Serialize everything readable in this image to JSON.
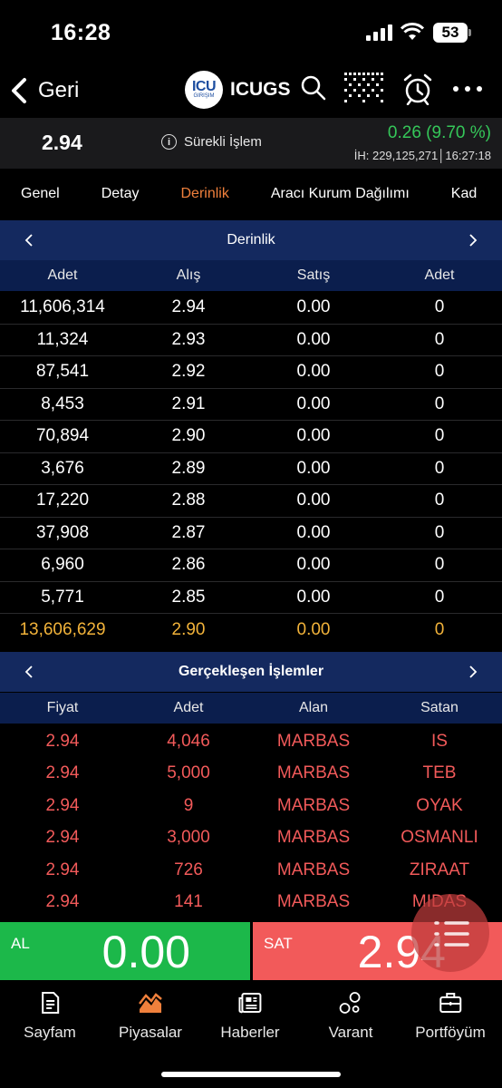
{
  "status_bar": {
    "time": "16:28",
    "battery": "53"
  },
  "nav": {
    "back_label": "Geri",
    "logo_main": "ICU",
    "logo_sub": "GIRIŞIM",
    "title": "ICUGS"
  },
  "quote": {
    "last_price": "2.94",
    "session": "Sürekli İşlem",
    "change": "0.26 (9.70 %)",
    "volume_line": "İH:  229,125,271│16:27:18"
  },
  "tabs": [
    "Genel",
    "Detay",
    "Derinlik",
    "Aracı Kurum Dağılımı",
    "Kad"
  ],
  "active_tab": "Derinlik",
  "depth": {
    "title": "Derinlik",
    "columns": [
      "Adet",
      "Alış",
      "Satış",
      "Adet"
    ],
    "rows": [
      [
        "11,606,314",
        "2.94",
        "0.00",
        "0"
      ],
      [
        "11,324",
        "2.93",
        "0.00",
        "0"
      ],
      [
        "87,541",
        "2.92",
        "0.00",
        "0"
      ],
      [
        "8,453",
        "2.91",
        "0.00",
        "0"
      ],
      [
        "70,894",
        "2.90",
        "0.00",
        "0"
      ],
      [
        "3,676",
        "2.89",
        "0.00",
        "0"
      ],
      [
        "17,220",
        "2.88",
        "0.00",
        "0"
      ],
      [
        "37,908",
        "2.87",
        "0.00",
        "0"
      ],
      [
        "6,960",
        "2.86",
        "0.00",
        "0"
      ],
      [
        "5,771",
        "2.85",
        "0.00",
        "0"
      ]
    ],
    "total": [
      "13,606,629",
      "2.90",
      "0.00",
      "0"
    ]
  },
  "trades": {
    "title": "Gerçekleşen İşlemler",
    "columns": [
      "Fiyat",
      "Adet",
      "Alan",
      "Satan"
    ],
    "rows": [
      [
        "2.94",
        "4,046",
        "MARBAS",
        "IS"
      ],
      [
        "2.94",
        "5,000",
        "MARBAS",
        "TEB"
      ],
      [
        "2.94",
        "9",
        "MARBAS",
        "OYAK"
      ],
      [
        "2.94",
        "3,000",
        "MARBAS",
        "OSMANLI"
      ],
      [
        "2.94",
        "726",
        "MARBAS",
        "ZIRAAT"
      ],
      [
        "2.94",
        "141",
        "MARBAS",
        "MIDAS"
      ]
    ]
  },
  "actions": {
    "buy_label": "AL",
    "buy_value": "0.00",
    "sell_label": "SAT",
    "sell_value": "2.94"
  },
  "bottom_nav": [
    {
      "label": "Sayfam",
      "icon": "document-icon"
    },
    {
      "label": "Piyasalar",
      "icon": "market-chart-icon"
    },
    {
      "label": "Haberler",
      "icon": "news-icon"
    },
    {
      "label": "Varant",
      "icon": "bubbles-icon"
    },
    {
      "label": "Portföyüm",
      "icon": "briefcase-icon"
    }
  ],
  "colors": {
    "accent": "#f0803c",
    "positive": "#35c759",
    "trade_text": "#f25a5a",
    "section_bg": "#14295f",
    "total_row": "#f2b33a",
    "buy": "#1cb84a",
    "sell": "#f25a5a"
  }
}
